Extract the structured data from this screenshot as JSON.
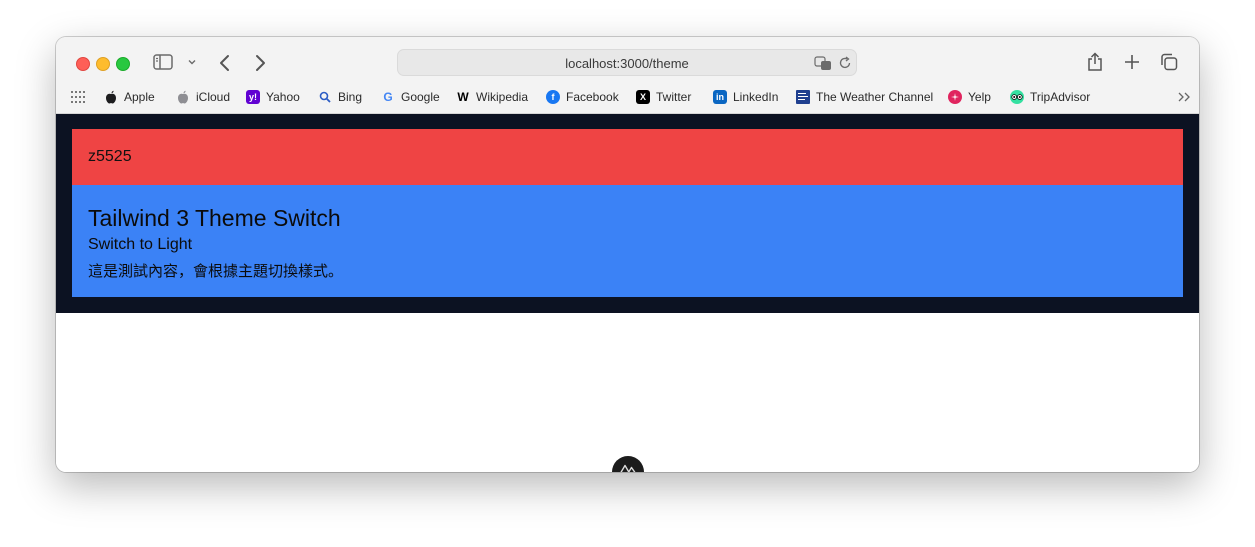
{
  "browser": {
    "url": "localhost:3000/theme",
    "bookmarks": [
      {
        "label": "Apple",
        "icon": "apple-icon",
        "color": "#1d1d1f",
        "glyph": ""
      },
      {
        "label": "iCloud",
        "icon": "icloud-icon",
        "color": "#8e8e93",
        "glyph": ""
      },
      {
        "label": "Yahoo",
        "icon": "yahoo-icon",
        "color": "#6001d2",
        "glyph": "y!"
      },
      {
        "label": "Bing",
        "icon": "bing-search-icon",
        "color": "#2b5cc4",
        "glyph": ""
      },
      {
        "label": "Google",
        "icon": "google-icon",
        "color": "#4285f4",
        "glyph": "G"
      },
      {
        "label": "Wikipedia",
        "icon": "wikipedia-icon",
        "color": "#000000",
        "glyph": "W"
      },
      {
        "label": "Facebook",
        "icon": "facebook-icon",
        "color": "#1877f2",
        "glyph": "f"
      },
      {
        "label": "Twitter",
        "icon": "x-twitter-icon",
        "color": "#000000",
        "glyph": "X"
      },
      {
        "label": "LinkedIn",
        "icon": "linkedin-icon",
        "color": "#0a66c2",
        "glyph": "in"
      },
      {
        "label": "The Weather Channel",
        "icon": "weather-channel-icon",
        "color": "#1f3f8f",
        "glyph": ""
      },
      {
        "label": "Yelp",
        "icon": "yelp-icon",
        "color": "#e0245e",
        "glyph": ""
      },
      {
        "label": "TripAdvisor",
        "icon": "tripadvisor-icon",
        "color": "#34e0a1",
        "glyph": ""
      }
    ]
  },
  "page": {
    "header_text": "z5525",
    "title": "Tailwind 3 Theme Switch",
    "switch_label": "Switch to Light",
    "description": "這是測試內容，會根據主題切換樣式。"
  },
  "colors": {
    "dark_background": "#0c1222",
    "header_red": "#ef4444",
    "panel_blue": "#3b82f6"
  }
}
